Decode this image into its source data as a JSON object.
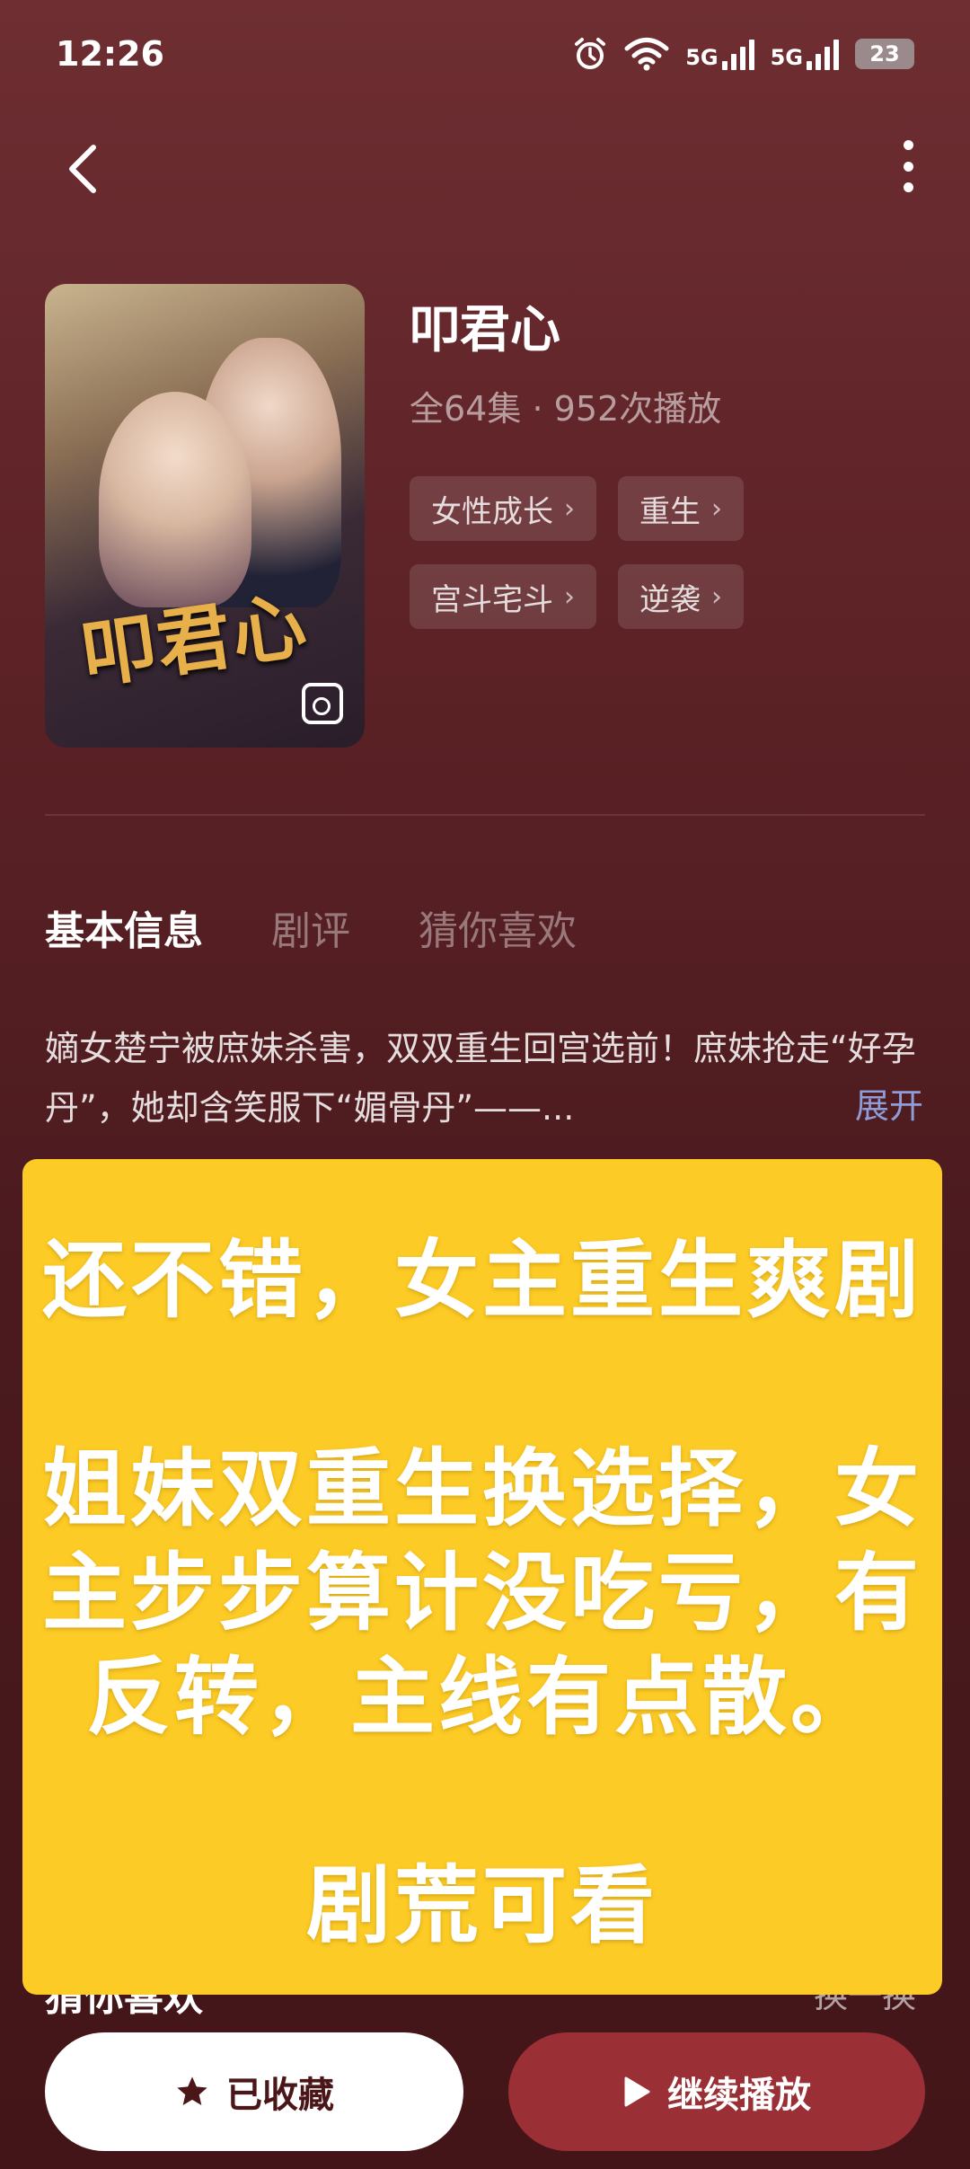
{
  "status_bar": {
    "time": "12:26",
    "network_1": "5G",
    "network_2": "5G",
    "battery": "23"
  },
  "show": {
    "title": "叩君心",
    "poster_title": "叩君心",
    "episodes": "全64集",
    "separator": "·",
    "plays": "952次播放",
    "tags": [
      "女性成长",
      "重生",
      "宫斗宅斗",
      "逆袭"
    ]
  },
  "tabs": [
    {
      "label": "基本信息",
      "active": true
    },
    {
      "label": "剧评",
      "active": false
    },
    {
      "label": "猜你喜欢",
      "active": false
    }
  ],
  "description": {
    "text": "嫡女楚宁被庶妹杀害，双双重生回宫选前！庶妹抢走“好孕丹”，她却含笑服下“媚骨丹”——...",
    "expand_label": "展开"
  },
  "overlay": {
    "lines": [
      "还不错，女主重生爽剧",
      "",
      "姐妹双重生换选择，女",
      "主步步算计没吃亏，有",
      "反转，主线有点散。",
      "",
      "剧荒可看"
    ],
    "color": "#fccb25"
  },
  "section": {
    "title": "猜你喜欢",
    "refresh_label": "换一换"
  },
  "actions": {
    "favorite_label": "已收藏",
    "play_label": "继续播放"
  },
  "colors": {
    "background": "#5c2226",
    "play_button": "#9a2f35",
    "expand_link": "#8e9dd9"
  },
  "icons": {
    "back": "chevron-left-icon",
    "more": "more-vertical-icon",
    "favorite": "star-icon",
    "play": "play-icon",
    "gallery": "image-gallery-icon"
  }
}
